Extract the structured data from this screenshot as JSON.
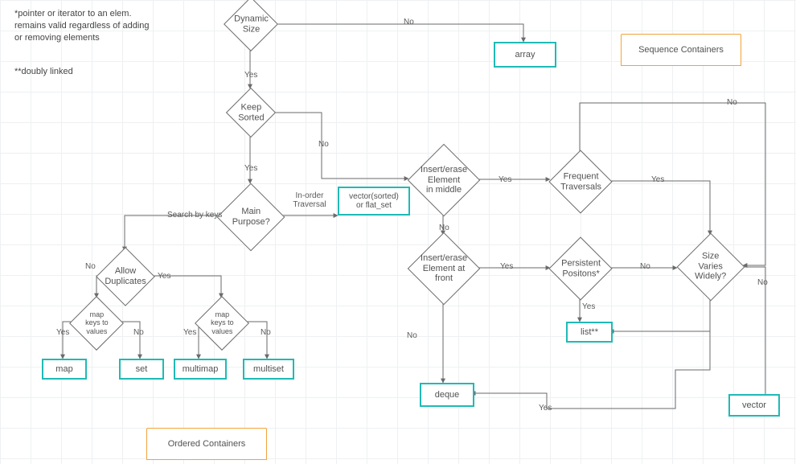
{
  "notes": {
    "star": "*pointer or iterator to an elem. remains valid regardless of adding or removing elements",
    "dstar": "**doubly linked"
  },
  "banners": {
    "sequence": "Sequence Containers",
    "ordered": "Ordered Containers"
  },
  "diamonds": {
    "dynamic": "Dynamic\nSize",
    "keepSorted": "Keep\nSorted",
    "mainPurpose": "Main Purpose?",
    "allowDup": "Allow\nDuplicates",
    "mapKV1": "map keys to\nvalues",
    "mapKV2": "map keys to\nvalues",
    "insertMid": "Insert/erase\nElement\nin middle",
    "insertFront": "Insert/erase\nElement at\nfront",
    "freqTrav": "Frequent\nTraversals",
    "persistPos": "Persistent\nPositons*",
    "sizeVaries": "Size\nVaries\nWidely?"
  },
  "rects": {
    "array": "array",
    "vecSorted": "vector(sorted)\nor flat_set",
    "map": "map",
    "set": "set",
    "multimap": "multimap",
    "multiset": "multiset",
    "deque": "deque",
    "vector": "vector",
    "list": "list**"
  },
  "labels": {
    "yes": "Yes",
    "no": "No",
    "searchByKeys": "Search by keys",
    "inOrder": "In-order\nTraversal"
  },
  "chart_data": {
    "type": "flowchart",
    "title": "C++ Container Selection",
    "nodes": [
      {
        "id": "dynamic",
        "kind": "decision",
        "text": "Dynamic Size"
      },
      {
        "id": "array",
        "kind": "terminal",
        "text": "array"
      },
      {
        "id": "keepSorted",
        "kind": "decision",
        "text": "Keep Sorted"
      },
      {
        "id": "mainPurpose",
        "kind": "decision",
        "text": "Main Purpose?"
      },
      {
        "id": "vecSorted",
        "kind": "terminal",
        "text": "vector(sorted) or flat_set"
      },
      {
        "id": "allowDup",
        "kind": "decision",
        "text": "Allow Duplicates"
      },
      {
        "id": "mapKV_noDup",
        "kind": "decision",
        "text": "map keys to values"
      },
      {
        "id": "mapKV_dup",
        "kind": "decision",
        "text": "map keys to values"
      },
      {
        "id": "map",
        "kind": "terminal",
        "text": "map"
      },
      {
        "id": "set",
        "kind": "terminal",
        "text": "set"
      },
      {
        "id": "multimap",
        "kind": "terminal",
        "text": "multimap"
      },
      {
        "id": "multiset",
        "kind": "terminal",
        "text": "multiset"
      },
      {
        "id": "insertMid",
        "kind": "decision",
        "text": "Insert/erase Element in middle"
      },
      {
        "id": "freqTrav",
        "kind": "decision",
        "text": "Frequent Traversals"
      },
      {
        "id": "insertFront",
        "kind": "decision",
        "text": "Insert/erase Element at front"
      },
      {
        "id": "persistPos",
        "kind": "decision",
        "text": "Persistent Positons*"
      },
      {
        "id": "sizeVaries",
        "kind": "decision",
        "text": "Size Varies Widely?"
      },
      {
        "id": "list",
        "kind": "terminal",
        "text": "list**"
      },
      {
        "id": "deque",
        "kind": "terminal",
        "text": "deque"
      },
      {
        "id": "vector",
        "kind": "terminal",
        "text": "vector"
      }
    ],
    "edges": [
      {
        "from": "dynamic",
        "to": "array",
        "label": "No"
      },
      {
        "from": "dynamic",
        "to": "keepSorted",
        "label": "Yes"
      },
      {
        "from": "keepSorted",
        "to": "mainPurpose",
        "label": "Yes"
      },
      {
        "from": "keepSorted",
        "to": "insertMid",
        "label": "No"
      },
      {
        "from": "mainPurpose",
        "to": "vecSorted",
        "label": "In-order Traversal"
      },
      {
        "from": "mainPurpose",
        "to": "allowDup",
        "label": "Search by keys"
      },
      {
        "from": "allowDup",
        "to": "mapKV_noDup",
        "label": "No"
      },
      {
        "from": "allowDup",
        "to": "mapKV_dup",
        "label": "Yes"
      },
      {
        "from": "mapKV_noDup",
        "to": "map",
        "label": "Yes"
      },
      {
        "from": "mapKV_noDup",
        "to": "set",
        "label": "No"
      },
      {
        "from": "mapKV_dup",
        "to": "multimap",
        "label": "Yes"
      },
      {
        "from": "mapKV_dup",
        "to": "multiset",
        "label": "No"
      },
      {
        "from": "insertMid",
        "to": "freqTrav",
        "label": "Yes"
      },
      {
        "from": "insertMid",
        "to": "insertFront",
        "label": "No"
      },
      {
        "from": "freqTrav",
        "to": "sizeVaries",
        "label": "Yes"
      },
      {
        "from": "freqTrav",
        "to": "sizeVaries",
        "label": "No"
      },
      {
        "from": "insertFront",
        "to": "persistPos",
        "label": "Yes"
      },
      {
        "from": "insertFront",
        "to": "deque",
        "label": "No"
      },
      {
        "from": "persistPos",
        "to": "list",
        "label": "Yes"
      },
      {
        "from": "persistPos",
        "to": "sizeVaries",
        "label": "No"
      },
      {
        "from": "sizeVaries",
        "to": "list",
        "label": "Yes"
      },
      {
        "from": "sizeVaries",
        "to": "vector",
        "label": "No"
      }
    ],
    "groups": [
      {
        "banner": "Sequence Containers",
        "members": [
          "array",
          "vecSorted",
          "deque",
          "vector",
          "list"
        ]
      },
      {
        "banner": "Ordered Containers",
        "members": [
          "map",
          "set",
          "multimap",
          "multiset"
        ]
      }
    ],
    "footnotes": [
      "*pointer or iterator to an elem. remains valid regardless of adding or removing elements",
      "**doubly linked"
    ]
  }
}
